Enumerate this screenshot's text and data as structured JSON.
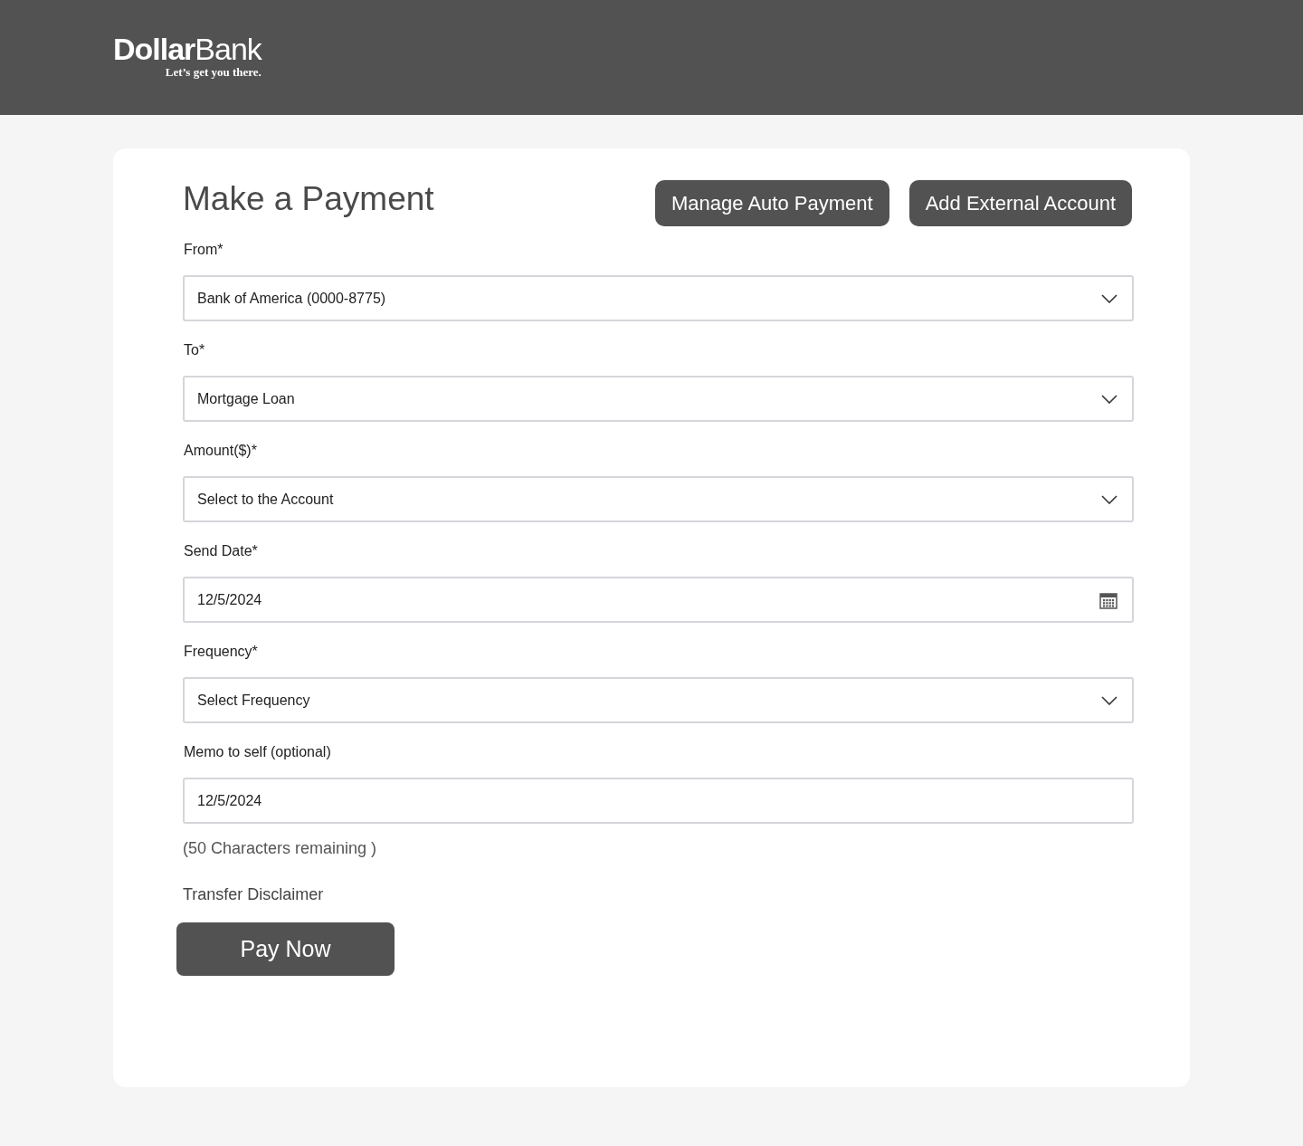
{
  "header": {
    "logo": "**Dollar**Bank",
    "tagline": "Let’s get you there."
  },
  "title": "Make a Payment",
  "actions": [
    "Manage Auto Payment",
    "Add External Account"
  ],
  "fields": [
    {
      "label": "From*",
      "kind": "select",
      "value": "Bank of America (0000-8775)"
    },
    {
      "label": "To*",
      "kind": "select",
      "value": "Mortgage Loan"
    },
    {
      "label": "Amount($)*",
      "kind": "select",
      "value": "Select to the Account"
    },
    {
      "label": "Send Date*",
      "kind": "date",
      "value": "12/5/2024"
    },
    {
      "label": "Frequency*",
      "kind": "select",
      "value": "Select Frequency"
    },
    {
      "label": "Memo to self (optional)",
      "kind": "text",
      "value": "12/5/2024"
    }
  ],
  "remaining": "(50 Characters remaining )",
  "disclaimer": "Transfer Disclaimer",
  "submit": "Pay Now"
}
